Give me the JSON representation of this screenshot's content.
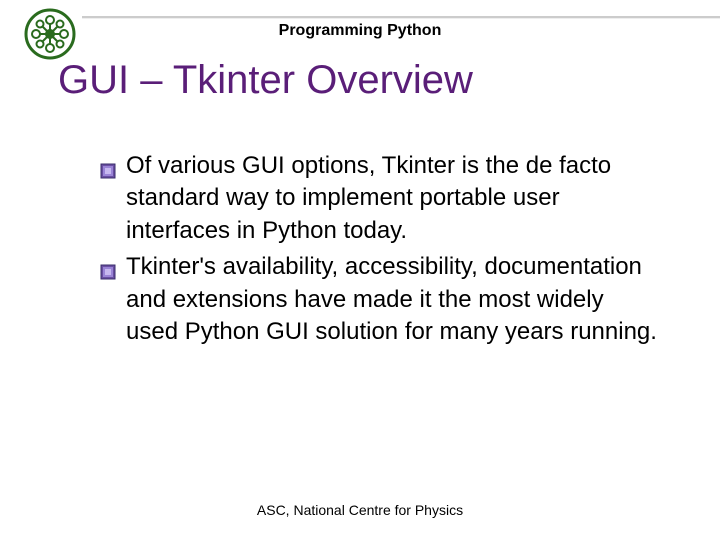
{
  "header": {
    "course": "Programming Python"
  },
  "title": "GUI – Tkinter Overview",
  "bullets": [
    "Of various GUI options, Tkinter is the de facto standard way to implement portable user interfaces in Python today.",
    "Tkinter's availability, accessibility, documentation and extensions have made it the most widely used Python GUI solution for many years running."
  ],
  "footer": "ASC, National Centre for Physics"
}
